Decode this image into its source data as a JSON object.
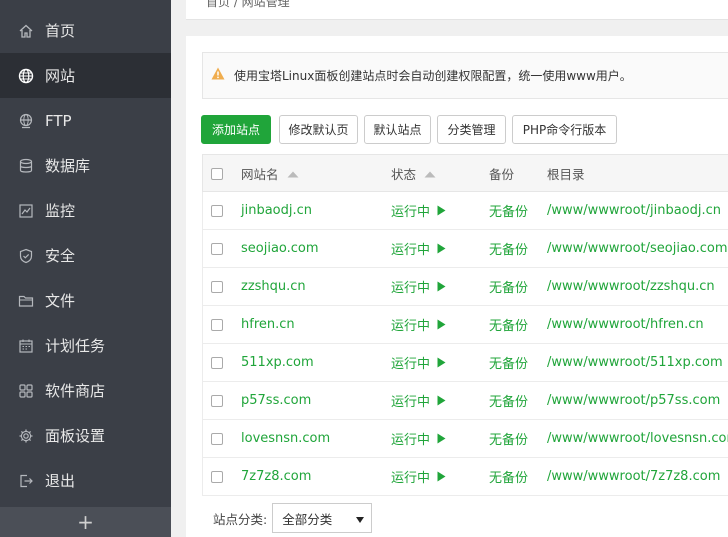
{
  "sidebar": {
    "items": [
      {
        "label": "首页",
        "icon": "home-icon"
      },
      {
        "label": "网站",
        "icon": "globe-icon"
      },
      {
        "label": "FTP",
        "icon": "ftp-globe-icon"
      },
      {
        "label": "数据库",
        "icon": "database-icon"
      },
      {
        "label": "监控",
        "icon": "monitor-chart-icon"
      },
      {
        "label": "安全",
        "icon": "shield-icon"
      },
      {
        "label": "文件",
        "icon": "folder-icon"
      },
      {
        "label": "计划任务",
        "icon": "calendar-icon"
      },
      {
        "label": "软件商店",
        "icon": "grid-apps-icon"
      },
      {
        "label": "面板设置",
        "icon": "gear-icon"
      },
      {
        "label": "退出",
        "icon": "logout-icon"
      }
    ],
    "active_index": 1,
    "add_symbol": "+"
  },
  "breadcrumb": "首页 / 网站管理",
  "notice": {
    "text": "使用宝塔Linux面板创建站点时会自动创建权限配置，统一使用www用户。",
    "icon": "warning-icon",
    "icon_color": "#f0ad4e"
  },
  "toolbar": {
    "add_site": "添加站点",
    "edit_default_page": "修改默认页",
    "default_site": "默认站点",
    "category_manage": "分类管理",
    "php_cli_version": "PHP命令行版本"
  },
  "table": {
    "headers": {
      "site_name": "网站名",
      "status": "状态",
      "backup": "备份",
      "root_dir": "根目录"
    },
    "rows": [
      {
        "name": "jinbaodj.cn",
        "status": "运行中",
        "backup": "无备份",
        "path": "/www/wwwroot/jinbaodj.cn"
      },
      {
        "name": "seojiao.com",
        "status": "运行中",
        "backup": "无备份",
        "path": "/www/wwwroot/seojiao.com"
      },
      {
        "name": "zzshqu.cn",
        "status": "运行中",
        "backup": "无备份",
        "path": "/www/wwwroot/zzshqu.cn"
      },
      {
        "name": "hfren.cn",
        "status": "运行中",
        "backup": "无备份",
        "path": "/www/wwwroot/hfren.cn"
      },
      {
        "name": "511xp.com",
        "status": "运行中",
        "backup": "无备份",
        "path": "/www/wwwroot/511xp.com"
      },
      {
        "name": "p57ss.com",
        "status": "运行中",
        "backup": "无备份",
        "path": "/www/wwwroot/p57ss.com"
      },
      {
        "name": "lovesnsn.com",
        "status": "运行中",
        "backup": "无备份",
        "path": "/www/wwwroot/lovesnsn.com"
      },
      {
        "name": "7z7z8.com",
        "status": "运行中",
        "backup": "无备份",
        "path": "/www/wwwroot/7z7z8.com"
      }
    ]
  },
  "filter": {
    "label": "站点分类:",
    "selected": "全部分类"
  },
  "colors": {
    "accent": "#20a53a",
    "sidebar_bg": "#3b3f47",
    "sidebar_active": "#2c2f35"
  }
}
